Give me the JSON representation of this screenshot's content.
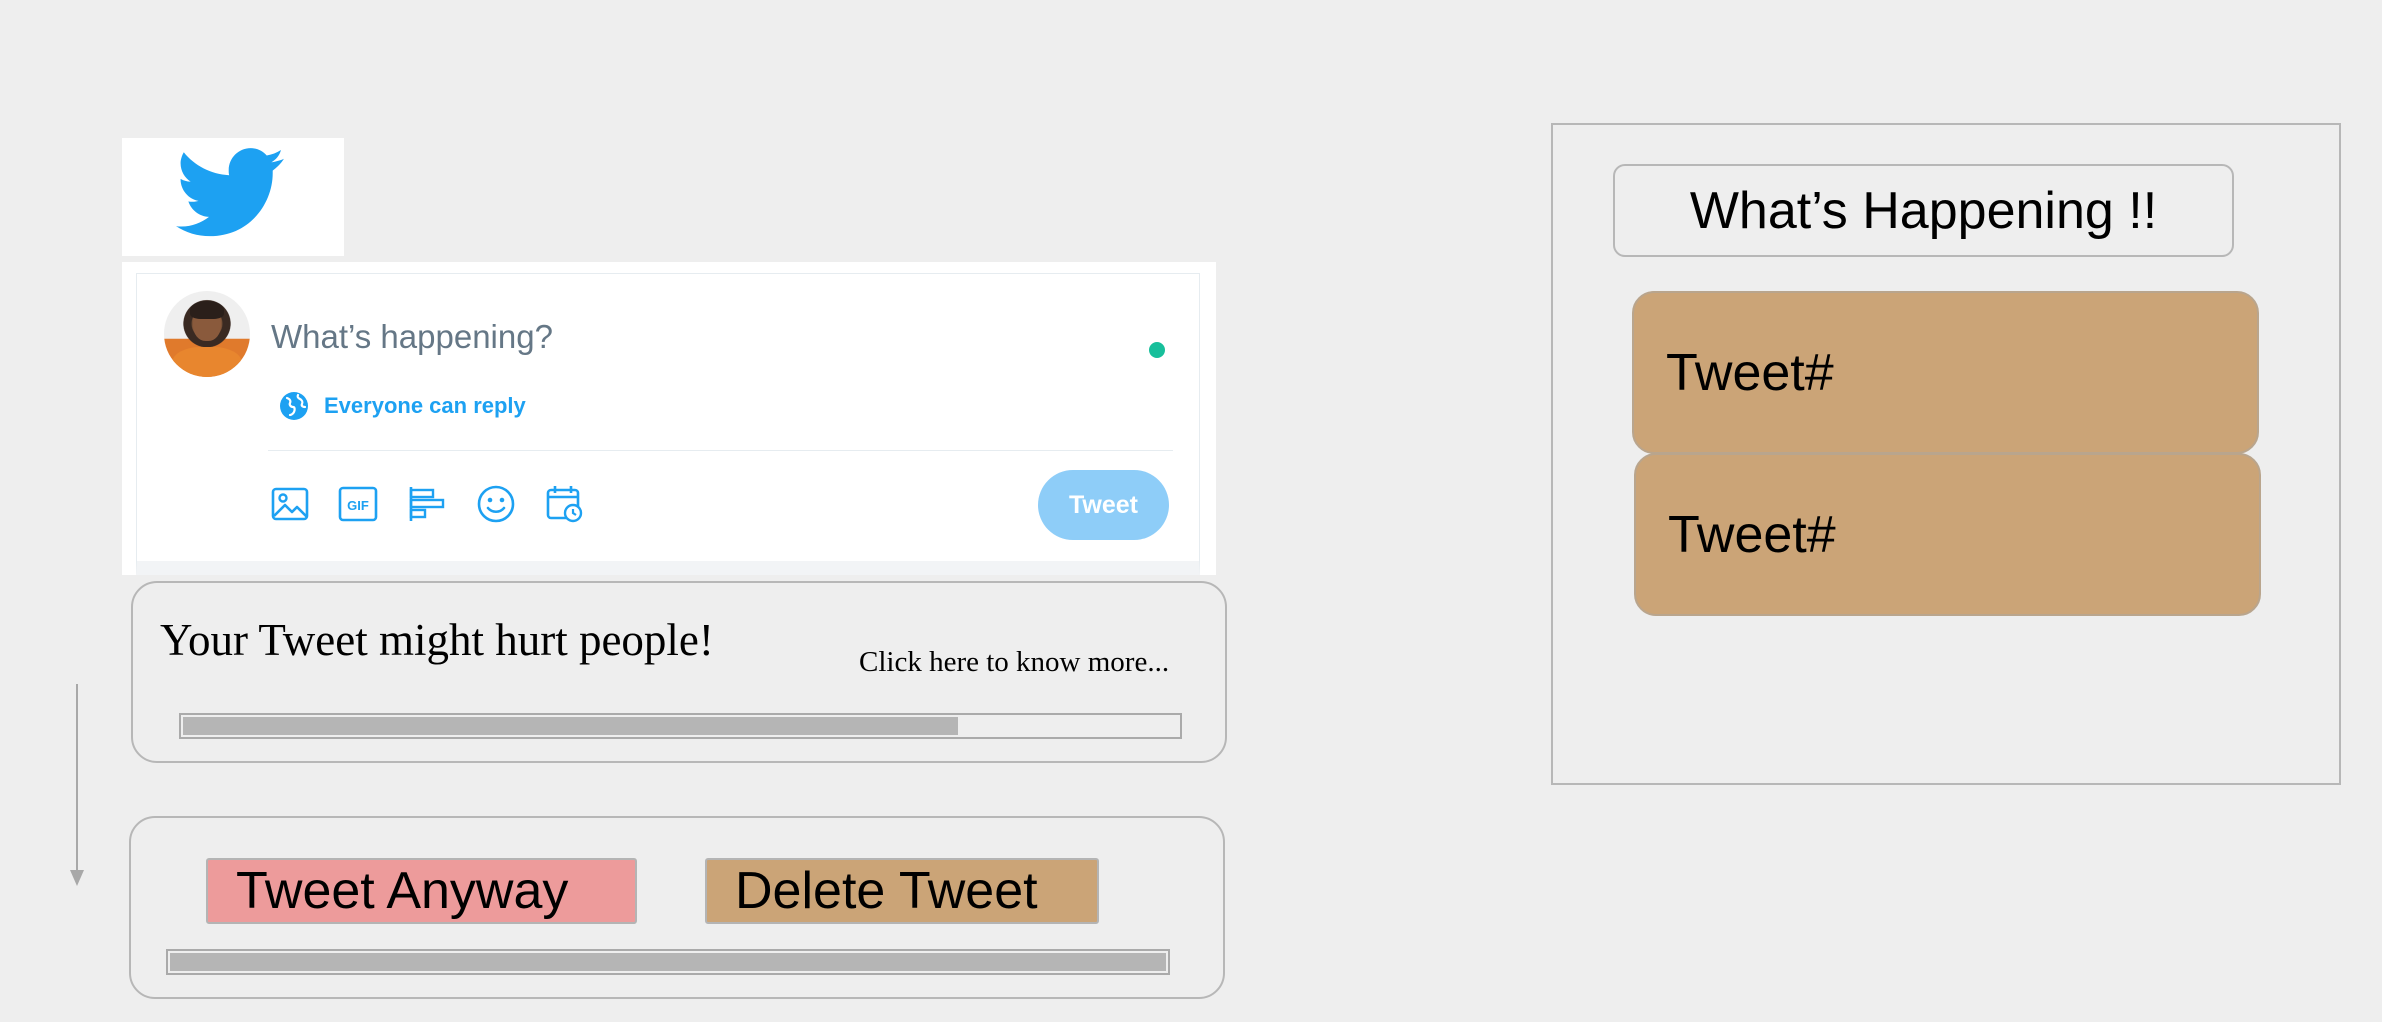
{
  "logo": {
    "icon": "twitter-bird-icon",
    "color": "#1da1f2"
  },
  "composer": {
    "placeholder": "What’s happening?",
    "reply_setting": "Everyone can reply",
    "tools": [
      "image-icon",
      "gif-icon",
      "poll-icon",
      "emoji-icon",
      "schedule-icon"
    ],
    "tweet_button": "Tweet"
  },
  "warning": {
    "message": "Your Tweet might hurt people!",
    "link": "Click here to know more...",
    "progress": 0.78
  },
  "actions": {
    "tweet_anyway": "Tweet Anyway",
    "delete_tweet": "Delete Tweet",
    "progress": 1.0
  },
  "feed": {
    "header": "What’s Happening !!",
    "tweets": [
      {
        "label": "Tweet#"
      },
      {
        "label": "Tweet#"
      }
    ]
  },
  "colors": {
    "accent": "#1da1f2",
    "tweet_button_disabled": "#8ecdf8",
    "tweet_anyway_bg": "#ed9b9b",
    "delete_bg": "#cba477",
    "tweet_card_bg": "#cba477",
    "status_dot": "#17bf9b"
  }
}
